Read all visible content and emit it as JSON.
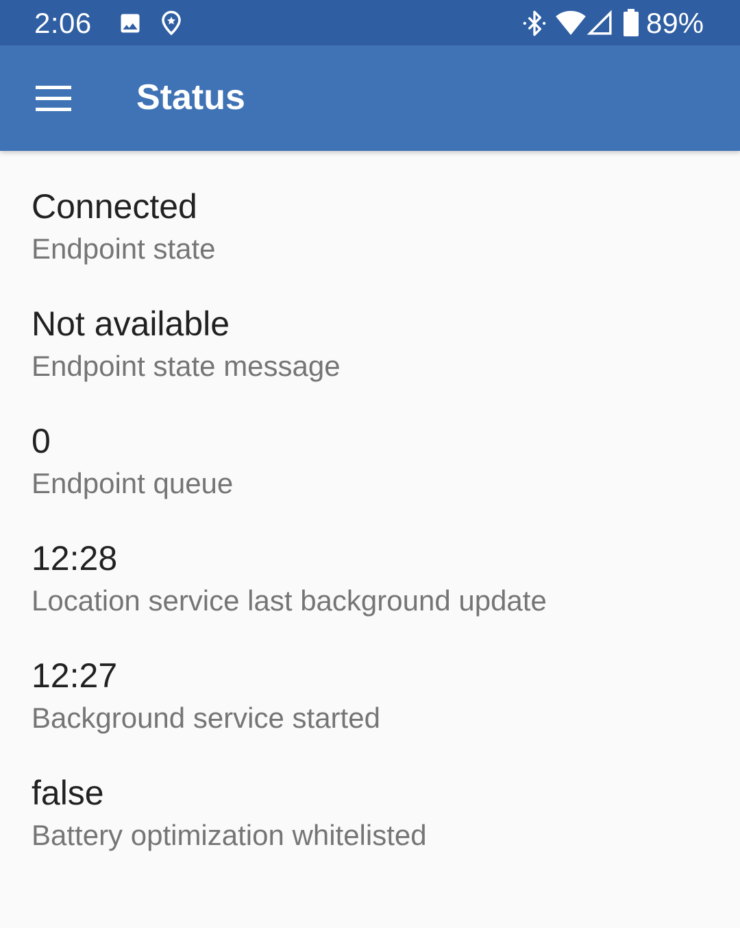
{
  "status_bar": {
    "time": "2:06",
    "battery_percent": "89%",
    "icons": [
      "image-icon",
      "location-pin-icon",
      "bluetooth-icon",
      "wifi-icon",
      "cell-signal-icon",
      "battery-icon"
    ]
  },
  "app_bar": {
    "title": "Status",
    "menu_icon": "hamburger-menu-icon",
    "color": "#3f73b5"
  },
  "items": [
    {
      "value": "Connected",
      "label": "Endpoint state"
    },
    {
      "value": "Not available",
      "label": "Endpoint state message"
    },
    {
      "value": "0",
      "label": "Endpoint queue"
    },
    {
      "value": "12:28",
      "label": "Location service last background update"
    },
    {
      "value": "12:27",
      "label": "Background service started"
    },
    {
      "value": "false",
      "label": "Battery optimization whitelisted"
    }
  ]
}
